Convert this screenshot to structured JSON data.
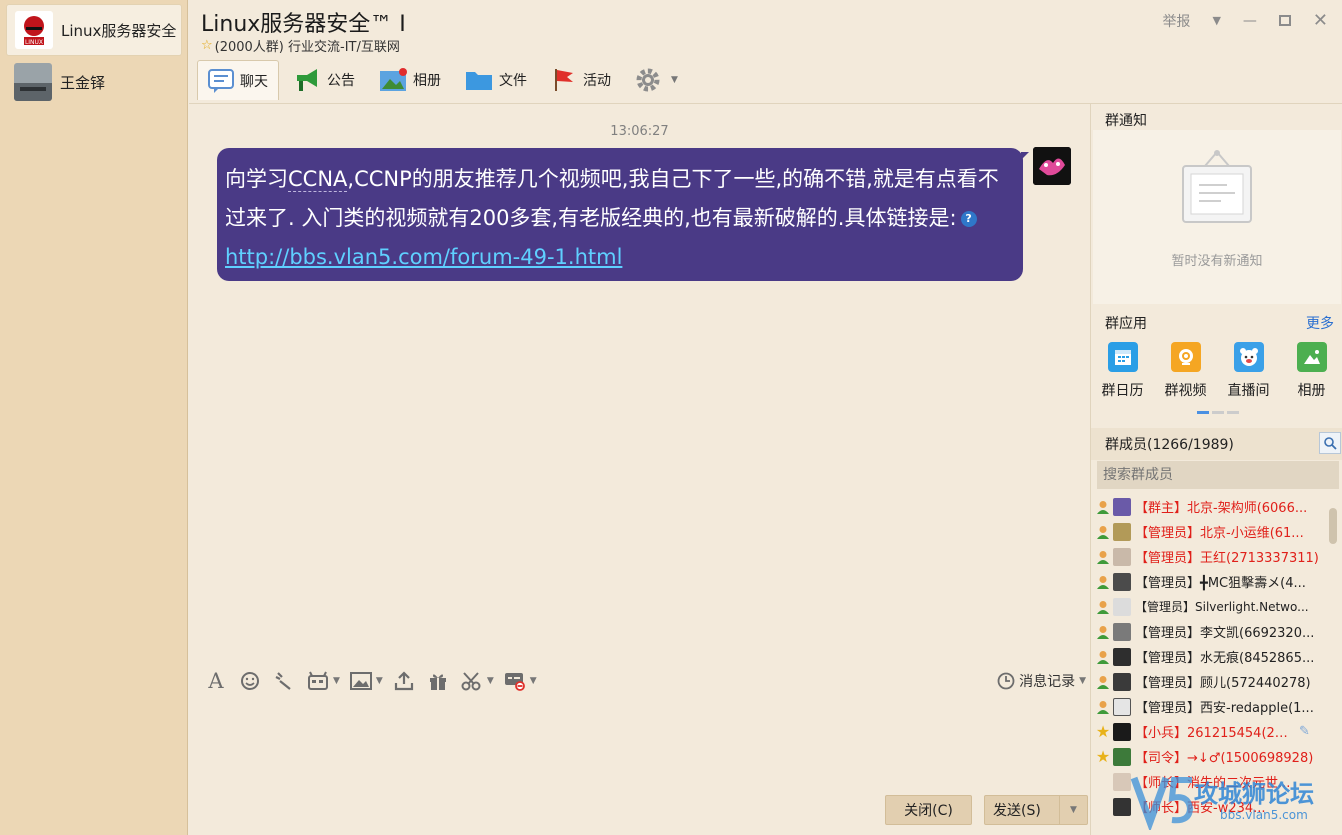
{
  "sidebar": {
    "conversations": [
      {
        "name": "Linux服务器安全"
      },
      {
        "name": "王金铎"
      }
    ]
  },
  "header": {
    "title": "Linux服务器安全™ Ⅰ",
    "subtitle": "(2000人群) 行业交流-IT/互联网",
    "report": "举报",
    "tabs": [
      {
        "label": "聊天",
        "icon": "chat-icon"
      },
      {
        "label": "公告",
        "icon": "megaphone-icon"
      },
      {
        "label": "相册",
        "icon": "photo-icon"
      },
      {
        "label": "文件",
        "icon": "folder-icon"
      },
      {
        "label": "活动",
        "icon": "flag-icon"
      }
    ]
  },
  "chat": {
    "timestamp": "13:06:27",
    "message": {
      "part1": "向学习",
      "term1": "CCNA",
      "part2": ",CCNP的朋友推荐几个视频吧,我自己下了一些,的确不错,就是有点看不过来了. 入门类的视频就有200多套,有老版经典的,也有最新破解的.具体链接是:",
      "link": "http://bbs.vlan5.com/forum-49-1.html"
    }
  },
  "input": {
    "history_label": "消息记录",
    "close_label": "关闭(C)",
    "send_label": "发送(S)"
  },
  "right_panel": {
    "notice_title": "群通知",
    "no_notice": "暂时没有新通知",
    "apps_title": "群应用",
    "more": "更多",
    "apps": [
      {
        "label": "群日历",
        "color": "#2a9ee6"
      },
      {
        "label": "群视频",
        "color": "#f5a623"
      },
      {
        "label": "直播间",
        "color": "#3aa0e8"
      },
      {
        "label": "相册",
        "color": "#4caf50"
      }
    ],
    "members_title": "群成员(1266/1989)",
    "search_placeholder": "搜索群成员",
    "members": [
      {
        "text": "【群主】北京-架构师(6066...",
        "color": "red"
      },
      {
        "text": "【管理员】北京-小运维(61...",
        "color": "red"
      },
      {
        "text": "【管理员】王红(2713337311)",
        "color": "red"
      },
      {
        "text": "【管理员】╋MC狙擊壽メ(4...",
        "color": "dark"
      },
      {
        "text": "【管理员】Silverlight.Netwo...",
        "color": "dark"
      },
      {
        "text": "【管理员】李文凯(6692320...",
        "color": "dark"
      },
      {
        "text": "【管理员】水无痕(8452865...",
        "color": "dark"
      },
      {
        "text": "【管理员】顾儿(572440278)",
        "color": "dark"
      },
      {
        "text": "【管理员】西安-redapple(1...",
        "color": "dark"
      },
      {
        "text": "【小兵】261215454(261...",
        "color": "red"
      },
      {
        "text": "【司令】→↓♂(1500698928)",
        "color": "red"
      },
      {
        "text": "【师长】消失的二次元世...",
        "color": "red"
      },
      {
        "text": "【师长】西安-w234...",
        "color": "red"
      }
    ]
  },
  "watermark": {
    "main": "攻城狮论坛",
    "sub": "bbs.vlan5.com"
  }
}
